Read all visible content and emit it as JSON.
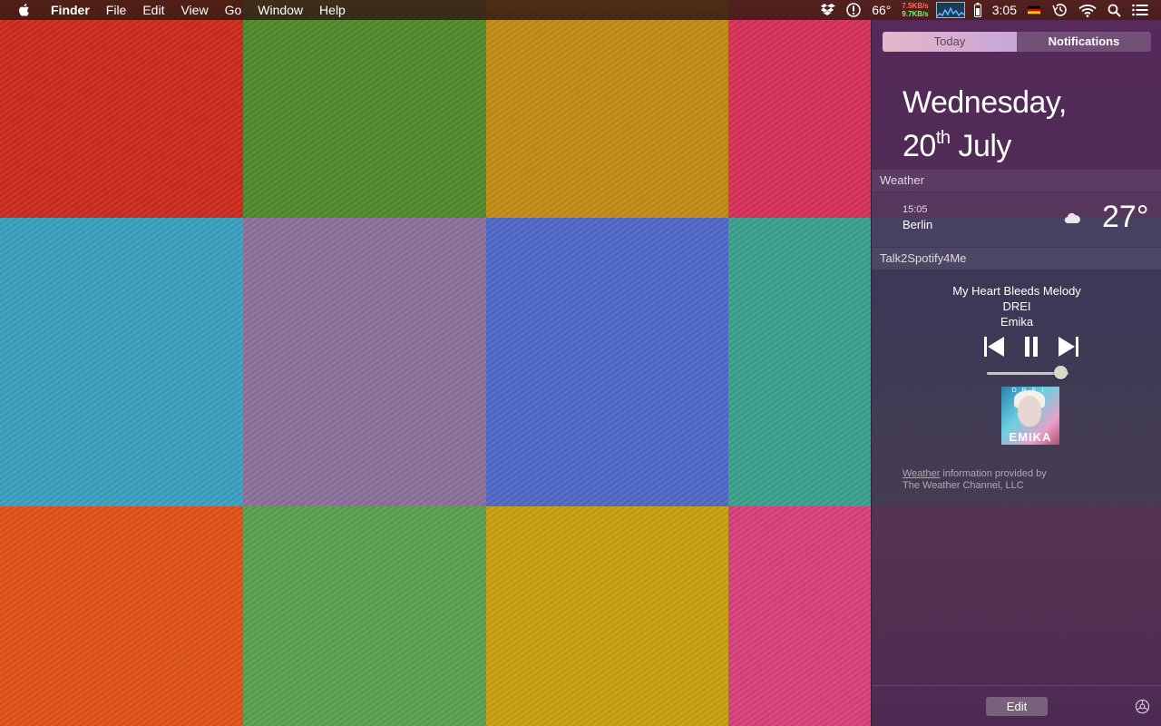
{
  "menubar": {
    "apple_icon": "apple-logo-icon",
    "app_name": "Finder",
    "menus": [
      "File",
      "Edit",
      "View",
      "Go",
      "Window",
      "Help"
    ],
    "status": {
      "temperature": "66°",
      "net_up": "7.5KB/s",
      "net_down": "9.7KB/s",
      "time": "3:05"
    }
  },
  "wallpaper": {
    "colors": [
      [
        "#cc2a1c",
        "#4f8a2a",
        "#c18a14",
        "#d8305a"
      ],
      [
        "#3aa0c0",
        "#8c709c",
        "#5068c8",
        "#3aa08c"
      ],
      [
        "#e05218",
        "#5aa050",
        "#c8a010",
        "#d8407a"
      ]
    ]
  },
  "notification_center": {
    "tabs": {
      "today": "Today",
      "notifications": "Notifications"
    },
    "date": {
      "weekday": "Wednesday,",
      "day": "20",
      "suffix": "th",
      "month": "July"
    },
    "weather": {
      "section_title": "Weather",
      "time": "15:05",
      "city": "Berlin",
      "condition_icon": "cloud-icon",
      "temperature": "27°"
    },
    "spotify": {
      "section_title": "Talk2Spotify4Me",
      "track": "My Heart Bleeds Melody",
      "album": "DREI",
      "artist": "Emika",
      "volume": 0.9,
      "album_art_top": "DREI",
      "album_art_bottom": "EMIKA"
    },
    "credit": {
      "link_text": "Weather",
      "line1_rest": " information provided by",
      "line2": "The Weather Channel, LLC"
    },
    "edit_label": "Edit"
  }
}
